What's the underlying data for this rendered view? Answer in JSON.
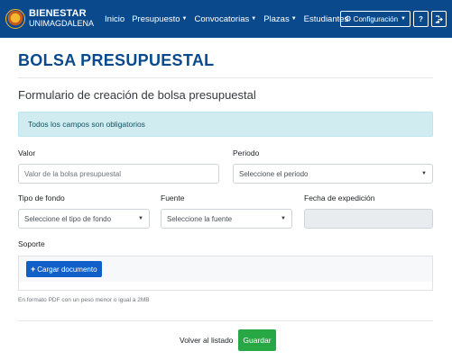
{
  "navbar": {
    "brand_title": "BIENESTAR",
    "brand_sub": "UNIMAGDALENA",
    "links": [
      {
        "label": "Inicio"
      },
      {
        "label": "Presupuesto"
      },
      {
        "label": "Convocatorias"
      },
      {
        "label": "Plazas"
      },
      {
        "label": "Estudiantes"
      }
    ],
    "config_label": "Configuración",
    "help_label": "?",
    "logout_icon": "logout-icon"
  },
  "page": {
    "title": "BOLSA PRESUPUESTAL",
    "form_title": "Formulario de creación de bolsa presupuestal",
    "alert": "Todos los campos son obligatorios"
  },
  "form": {
    "valor": {
      "label": "Valor",
      "placeholder": "Valor de la bolsa presupuestal"
    },
    "periodo": {
      "label": "Periodo",
      "value": "Seleccione el periodo"
    },
    "tipo_fondo": {
      "label": "Tipo de fondo",
      "value": "Seleccione el tipo de fondo"
    },
    "fuente": {
      "label": "Fuente",
      "value": "Seleccione la fuente"
    },
    "fecha": {
      "label": "Fecha de expedición",
      "value": ""
    },
    "soporte": {
      "label": "Soporte",
      "button": "Cargar documento",
      "help": "En formato PDF con un peso menor o igual a 2MB"
    }
  },
  "actions": {
    "back": "Volver al listado",
    "save": "Guardar"
  },
  "colors": {
    "navbar": "#0a4a8c",
    "title": "#0a4a8c",
    "alert_bg": "#d1ecf1",
    "primary": "#1160c9",
    "success": "#28a745"
  }
}
